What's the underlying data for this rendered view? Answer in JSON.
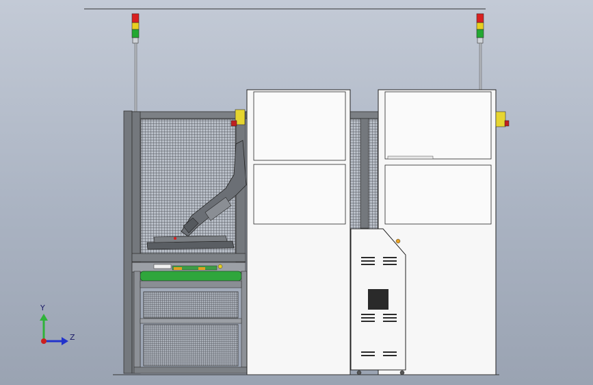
{
  "view": {
    "background_top": "#c3cad6",
    "background_bottom": "#9aa3b2"
  },
  "colors": {
    "frame": "#6e7277",
    "panel": "#f7f7f7",
    "panel_outline": "#333333",
    "mesh": "#56595e",
    "conveyor": "#2fa63c",
    "tower_red": "#d82020",
    "tower_yellow": "#e8d020",
    "tower_green": "#23a832",
    "warning": "#e6d530"
  },
  "triad": {
    "y_label": "Y",
    "z_label": "Z",
    "y_axis_color": "#2fb33a",
    "z_axis_color": "#2233cc",
    "origin_color": "#cc1f1f"
  }
}
